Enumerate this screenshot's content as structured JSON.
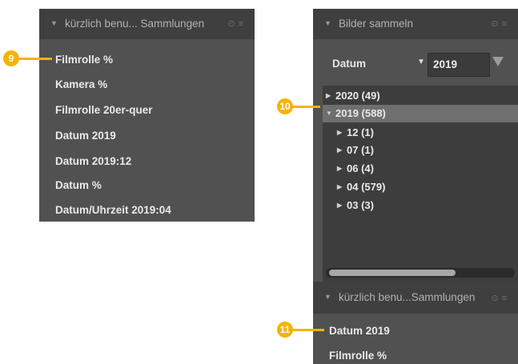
{
  "callouts": {
    "c9": "9",
    "c10": "10",
    "c11": "11"
  },
  "left_panel": {
    "title": "kürzlich benu... Sammlungen",
    "items": [
      "Filmrolle %",
      "Kamera %",
      "Filmrolle 20er-quer",
      "Datum 2019",
      "Datum 2019:12",
      "Datum %",
      "Datum/Uhrzeit 2019:04"
    ]
  },
  "right_panel": {
    "title": "Bilder sammeln",
    "property_label": "Datum",
    "query_value": "2019",
    "tree": [
      {
        "label": "2020 (49)",
        "expanded": false,
        "level": 0
      },
      {
        "label": "2019 (588)",
        "expanded": true,
        "level": 0,
        "selected": true
      },
      {
        "label": "12 (1)",
        "expanded": false,
        "level": 1
      },
      {
        "label": "07 (1)",
        "expanded": false,
        "level": 1
      },
      {
        "label": "06 (4)",
        "expanded": false,
        "level": 1
      },
      {
        "label": "04 (579)",
        "expanded": false,
        "level": 1
      },
      {
        "label": "03 (3)",
        "expanded": false,
        "level": 1
      }
    ],
    "scroll_fraction_visible": 0.68,
    "recent_title": "kürzlich benu...Sammlungen",
    "recent_items": [
      "Datum 2019",
      "Filmrolle %"
    ]
  },
  "icons": {
    "expand": "triangle-right-icon",
    "collapse": "triangle-down-icon",
    "reset": "circle-icon",
    "presets": "hamburger-icon",
    "filter": "funnel-icon"
  },
  "colors": {
    "callout": "#f4b400",
    "panel": "#515151",
    "header": "#3f3f3f",
    "selection": "#6f6f6f"
  }
}
